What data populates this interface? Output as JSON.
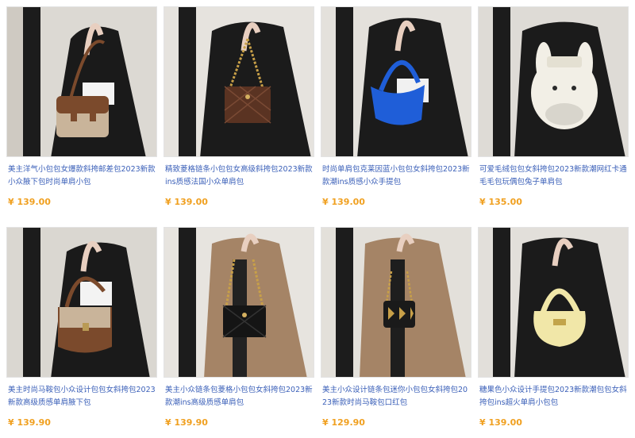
{
  "colors": {
    "link": "#3a5fb8",
    "price": "#f0a020",
    "border": "#e3e3e3"
  },
  "products": [
    {
      "title": "美主洋气小包包女爆款斜挎邮差包2023新款小众腋下包时尚单肩小包",
      "price": "¥ 139.00",
      "bag_color": "#8a6a4e",
      "bag_name": "brown-flap-bag"
    },
    {
      "title": "精致菱格链条小包包女高级斜挎包2023新款ins质感法国小众单肩包",
      "price": "¥ 139.00",
      "bag_color": "#5a3322",
      "bag_name": "quilted-chain-bag"
    },
    {
      "title": "时尚单肩包克莱因蓝小包包女斜挎包2023新款潮ins质感小众手提包",
      "price": "¥ 139.00",
      "bag_color": "#1f5ed8",
      "bag_name": "blue-hobo-bag"
    },
    {
      "title": "可爱毛绒包包女斜挎包2023新款潮网红卡通毛毛包玩偶包兔子单肩包",
      "price": "¥ 135.00",
      "bag_color": "#f2efe6",
      "bag_name": "plush-bunny-bag"
    },
    {
      "title": "美主时尚马鞍包小众设计包包女斜挎包2023新款高级质感单肩腋下包",
      "price": "¥ 139.90",
      "bag_color": "#a58466",
      "bag_name": "saddle-bag"
    },
    {
      "title": "美主小众链条包菱格小包包女斜挎包2023新款潮ins高级质感单肩包",
      "price": "¥ 139.90",
      "bag_color": "#151515",
      "bag_name": "black-chain-bag"
    },
    {
      "title": "美主小众设计链条包迷你小包包女斜挎包2023新款时尚马鞍包口红包",
      "price": "¥ 129.90",
      "bag_color": "#1a1a1a",
      "bag_name": "mini-diamond-bag"
    },
    {
      "title": "糖果色小众设计手提包2023新款潮包包女斜挎包ins超火单肩小包包",
      "price": "¥ 139.00",
      "bag_color": "#f1e7a8",
      "bag_name": "yellow-handbag"
    }
  ]
}
